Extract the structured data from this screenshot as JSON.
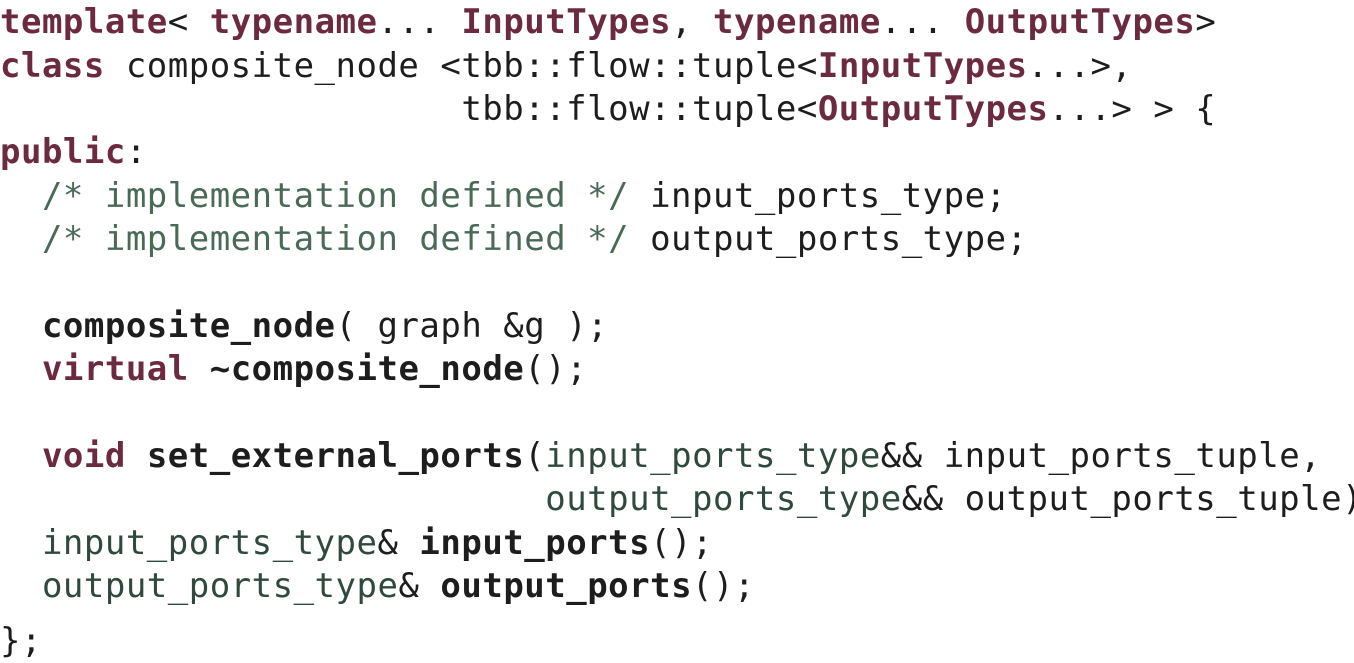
{
  "code": {
    "lines": [
      [
        {
          "t": "kw",
          "s": "template"
        },
        {
          "t": "text",
          "s": "< "
        },
        {
          "t": "kw",
          "s": "typename"
        },
        {
          "t": "text",
          "s": "... "
        },
        {
          "t": "type",
          "s": "InputTypes"
        },
        {
          "t": "text",
          "s": ", "
        },
        {
          "t": "kw",
          "s": "typename"
        },
        {
          "t": "text",
          "s": "... "
        },
        {
          "t": "type",
          "s": "OutputTypes"
        },
        {
          "t": "text",
          "s": ">"
        }
      ],
      [
        {
          "t": "kw",
          "s": "class"
        },
        {
          "t": "text",
          "s": " composite_node <tbb::flow::tuple<"
        },
        {
          "t": "type",
          "s": "InputTypes"
        },
        {
          "t": "text",
          "s": "...>,"
        }
      ],
      [
        {
          "t": "text",
          "s": "                      tbb::flow::tuple<"
        },
        {
          "t": "type",
          "s": "OutputTypes"
        },
        {
          "t": "text",
          "s": "...> > {"
        }
      ],
      [
        {
          "t": "kw",
          "s": "public"
        },
        {
          "t": "text",
          "s": ":"
        }
      ],
      [
        {
          "t": "text",
          "s": "  "
        },
        {
          "t": "cmt",
          "s": "/* implementation defined */"
        },
        {
          "t": "text",
          "s": " input_ports_type;"
        }
      ],
      [
        {
          "t": "text",
          "s": "  "
        },
        {
          "t": "cmt",
          "s": "/* implementation defined */"
        },
        {
          "t": "text",
          "s": " output_ports_type;"
        }
      ],
      [],
      [
        {
          "t": "text",
          "s": "  "
        },
        {
          "t": "name",
          "s": "composite_node"
        },
        {
          "t": "text",
          "s": "( graph &g );"
        }
      ],
      [
        {
          "t": "text",
          "s": "  "
        },
        {
          "t": "kw",
          "s": "virtual"
        },
        {
          "t": "text",
          "s": " "
        },
        {
          "t": "name",
          "s": "~composite_node"
        },
        {
          "t": "text",
          "s": "();"
        }
      ],
      [],
      [
        {
          "t": "text",
          "s": "  "
        },
        {
          "t": "kw",
          "s": "void"
        },
        {
          "t": "text",
          "s": " "
        },
        {
          "t": "name",
          "s": "set_external_ports"
        },
        {
          "t": "text",
          "s": "("
        },
        {
          "t": "var",
          "s": "input_ports_type"
        },
        {
          "t": "text",
          "s": "&& input_ports_tuple,"
        }
      ],
      [
        {
          "t": "text",
          "s": "                          "
        },
        {
          "t": "var",
          "s": "output_ports_type"
        },
        {
          "t": "text",
          "s": "&& output_ports_tuple);"
        }
      ],
      [
        {
          "t": "text",
          "s": "  "
        },
        {
          "t": "var",
          "s": "input_ports_type"
        },
        {
          "t": "text",
          "s": "& "
        },
        {
          "t": "name",
          "s": "input_ports"
        },
        {
          "t": "text",
          "s": "();"
        }
      ],
      [
        {
          "t": "text",
          "s": "  "
        },
        {
          "t": "var",
          "s": "output_ports_type"
        },
        {
          "t": "text",
          "s": "& "
        },
        {
          "t": "name",
          "s": "output_ports"
        },
        {
          "t": "text",
          "s": "();"
        }
      ],
      [
        {
          "t": "text",
          "s": "};"
        }
      ]
    ]
  }
}
